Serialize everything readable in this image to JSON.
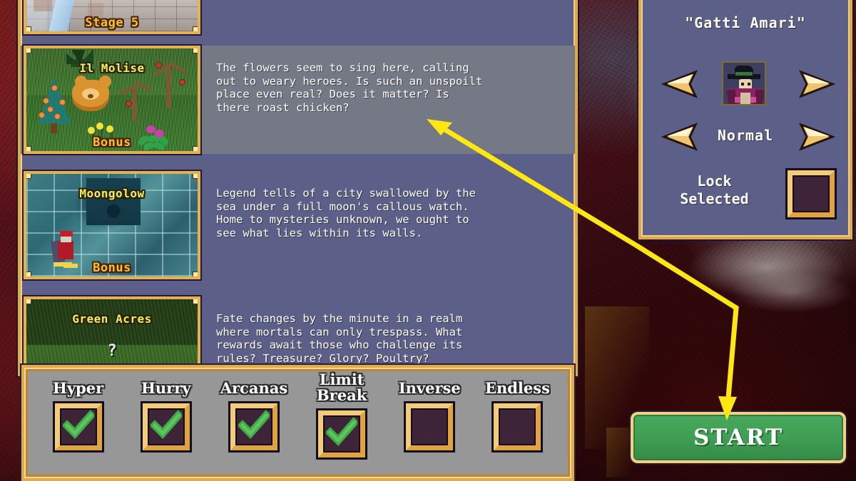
{
  "window": {
    "title": "Stage Select"
  },
  "colors": {
    "panel_bg": "#5c5f87",
    "panel_border_gold": "#dfa94a",
    "highlight_row": "#757885",
    "options_bar_bg": "#979797",
    "checkbox_inner": "#3d2438",
    "check_green": "#3faa46",
    "start_green": "#3f9f54",
    "annotation_yellow": "#ffe812",
    "stage_title_yellow": "#f2ef55",
    "bonus_tag_gold": "#f6c22b"
  },
  "stage_list": {
    "items": [
      {
        "name": "Stage 5",
        "title_in_thumb": "Stage 5",
        "tag": "",
        "description": "",
        "highlighted": false,
        "art": "castle-bricks"
      },
      {
        "name": "Il Molise",
        "title_in_thumb": "Il Molise",
        "tag": "Bonus",
        "description": "The flowers seem to sing here, calling\nout to weary heroes. Is such an unspoilt\nplace even real? Does it matter? Is\nthere roast chicken?",
        "highlighted": true,
        "art": "forest-meadow"
      },
      {
        "name": "Moongolow",
        "title_in_thumb": "Moongolow",
        "tag": "Bonus",
        "description": "Legend tells of a city swallowed by the\nsea under a full moon's callous watch.\nHome to mysteries unknown, we ought to\nsee what lies within its walls.",
        "highlighted": false,
        "art": "sunken-city"
      },
      {
        "name": "Green Acres",
        "title_in_thumb": "Green Acres",
        "tag": "",
        "question_mark": "?",
        "description": "Fate changes by the minute in a realm\nwhere mortals can only trespass. What\nrewards await those who challenge its\nrules? Treasure? Glory? Poultry?",
        "highlighted": false,
        "art": "green-grass"
      }
    ]
  },
  "options_bar": {
    "options": [
      {
        "label": "Hyper",
        "checked": true
      },
      {
        "label": "Hurry",
        "checked": true
      },
      {
        "label": "Arcanas",
        "checked": true
      },
      {
        "label": "Limit\nBreak",
        "checked": true
      },
      {
        "label": "Inverse",
        "checked": false
      },
      {
        "label": "Endless",
        "checked": false
      }
    ]
  },
  "character_panel": {
    "character_name": "\"Gatti Amari\"",
    "portrait_alt": "witch-character-portrait",
    "prev_character_icon": "left-arrow-icon",
    "next_character_icon": "right-arrow-icon",
    "difficulty": "Normal",
    "prev_difficulty_icon": "left-arrow-icon",
    "next_difficulty_icon": "right-arrow-icon",
    "lock_label": "Lock\nSelected",
    "lock_checked": false
  },
  "start_button": {
    "label": "START"
  },
  "annotations": {
    "arrow_1": "arrow pointing to Il Molise description panel",
    "arrow_2": "arrow pointing down to START button"
  }
}
